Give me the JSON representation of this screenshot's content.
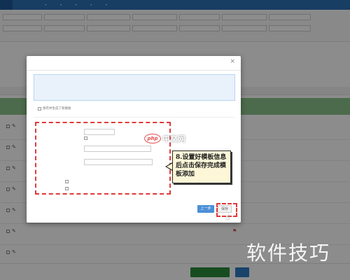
{
  "callout": {
    "text": "8.设置好模板信息后点击保存完成模板添加"
  },
  "watermarks": {
    "php_logo": "php",
    "php_site": "中文网",
    "site": "软件技巧"
  },
  "modal": {
    "save_as_template_label": "保存并生成了新模板",
    "prev_button": "上一步",
    "save_button": "保存"
  },
  "colors": {
    "accent": "#2f72b7",
    "highlight_dashed": "#e03a3a",
    "selected_row": "#8bc38b",
    "callout_bg": "#fdf7d8"
  },
  "icons": [
    "close-icon",
    "flag-icon",
    "edit-icon",
    "cursor-hand-icon",
    "dropdown-caret-icon"
  ]
}
